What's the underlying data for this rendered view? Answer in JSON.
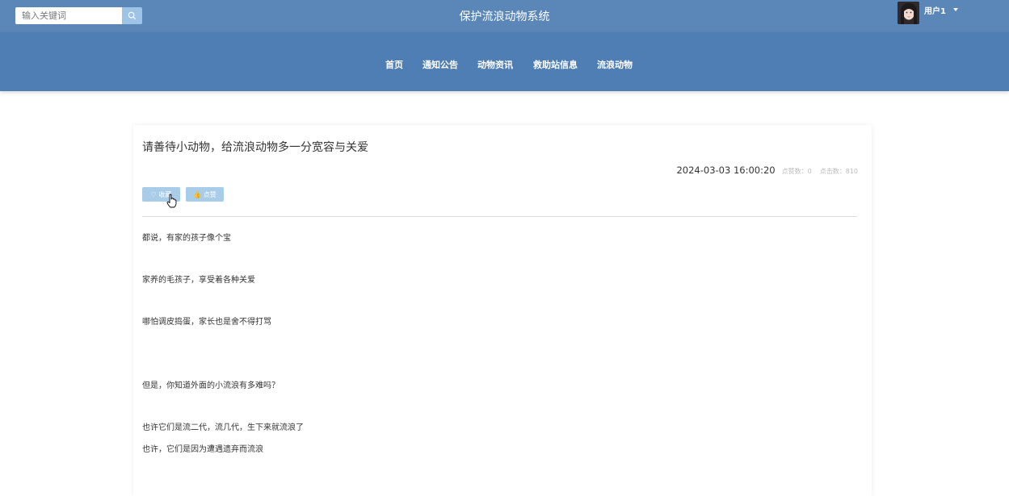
{
  "header": {
    "search_placeholder": "输入关键词",
    "site_title": "保护流浪动物系统",
    "user_name": "用户1"
  },
  "nav": {
    "items": [
      {
        "label": "首页"
      },
      {
        "label": "通知公告"
      },
      {
        "label": "动物资讯"
      },
      {
        "label": "救助站信息"
      },
      {
        "label": "流浪动物"
      }
    ]
  },
  "article": {
    "title": "请善待小动物，给流浪动物多一分宽容与关爱",
    "date": "2024-03-03 16:00:20",
    "likes": "点赞数：0",
    "clicks": "点击数：810",
    "collect_label": "♡ 收藏",
    "like_label": "👍 点赞",
    "paragraphs": [
      "都说，有家的孩子像个宝",
      "家养的毛孩子，享受着各种关爱",
      "哪怕调皮捣蛋，家长也是舍不得打骂",
      "但是，你知道外面的小流浪有多难吗？",
      "也许它们是流二代，流几代，生下来就流浪了",
      "也许，它们是因为遭遇遗弃而流浪"
    ]
  },
  "colors": {
    "topbar": "#5b86b8",
    "navbar": "#4f7eb4",
    "button": "#a9cce9"
  }
}
